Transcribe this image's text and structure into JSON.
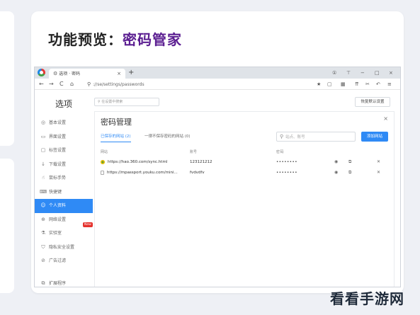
{
  "slide": {
    "title_prefix": "功能预览：",
    "title_accent": "密码管家",
    "accent_color": "#5b1e91"
  },
  "browser": {
    "tab_title": "选项 · 密码",
    "tab_icon": "gear-icon",
    "new_tab": "+",
    "url": "://se/settings/passwords",
    "window_controls": [
      "①",
      "⊤",
      "−",
      "□",
      "×"
    ],
    "nav": [
      "←",
      "→",
      "C",
      "⌂"
    ],
    "toolbar": [
      "★",
      "▢",
      "▦",
      "⇈",
      "✂",
      "↶",
      "≡"
    ]
  },
  "sidebar": {
    "title": "选项",
    "items": [
      {
        "label": "基本设置",
        "icon": "settings-icon"
      },
      {
        "label": "界面设置",
        "icon": "layout-icon"
      },
      {
        "label": "标签设置",
        "icon": "tab-icon"
      },
      {
        "label": "下载设置",
        "icon": "download-icon"
      },
      {
        "label": "鼠标手势",
        "icon": "gesture-icon"
      },
      {
        "label": "快捷键",
        "icon": "keyboard-icon"
      },
      {
        "label": "个人资料",
        "icon": "user-icon",
        "active": true
      },
      {
        "label": "网络设置",
        "icon": "network-icon"
      },
      {
        "label": "实验室",
        "icon": "lab-icon",
        "badge": "New"
      },
      {
        "label": "隐私安全设置",
        "icon": "shield-icon"
      },
      {
        "label": "广告过滤",
        "icon": "adblock-icon"
      },
      {
        "label": "扩展程序",
        "icon": "extension-icon"
      }
    ]
  },
  "page": {
    "search_placeholder": "在设置中搜索",
    "restore_button": "恢复默认设置"
  },
  "dialog": {
    "title": "密码管理",
    "close": "×",
    "tabs": [
      {
        "label": "已保存的网站 (2)",
        "active": true
      },
      {
        "label": "一律不保存密码的网站 (0)",
        "active": false
      }
    ],
    "search_placeholder": "站点、账号",
    "add_button": "添加网站",
    "columns": [
      "网站",
      "账号",
      "密码"
    ],
    "rows": [
      {
        "site": "https://hao.360.com/sync.html",
        "user": "123121212",
        "password": "••••••••",
        "favicon": "360-icon"
      },
      {
        "site": "https://mpassport.youku.com/mini...",
        "user": "fvdvdfv",
        "password": "••••••••",
        "favicon": "document-icon"
      }
    ]
  },
  "watermark": "看看手游网"
}
